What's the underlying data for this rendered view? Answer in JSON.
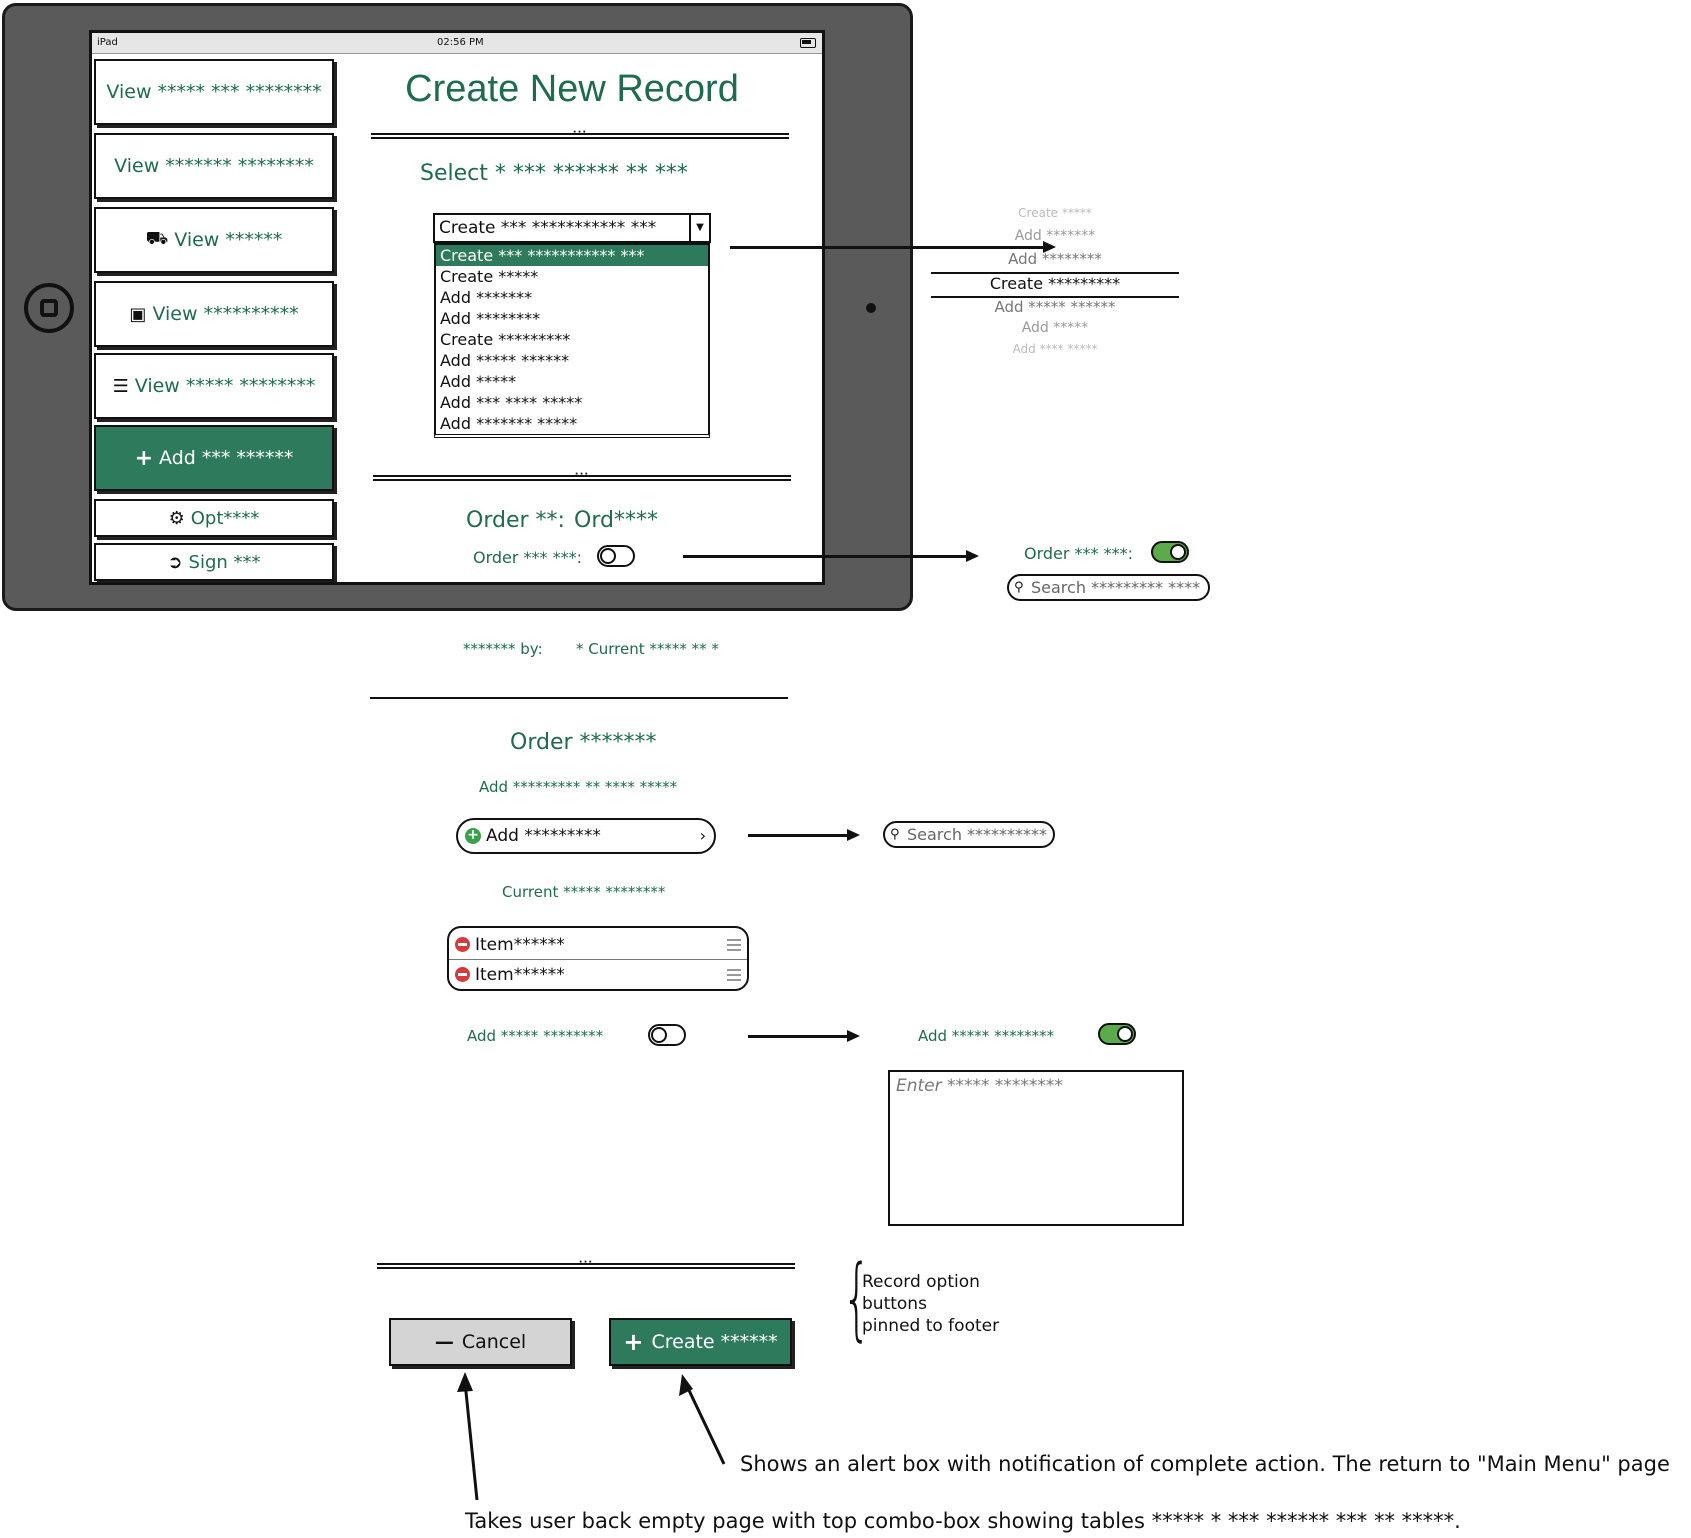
{
  "status_bar": {
    "device": "iPad",
    "time": "02:56 PM"
  },
  "sidebar": {
    "items": [
      {
        "label": "View ***** *** ********",
        "icon": ""
      },
      {
        "label": "View ******* ********",
        "icon": ""
      },
      {
        "label": "View ******",
        "icon": "truck-icon"
      },
      {
        "label": "View **********",
        "icon": "inbox-icon"
      },
      {
        "label": "View ***** ********",
        "icon": "database-icon"
      },
      {
        "label": "Add *** ******",
        "icon": "plus-icon"
      },
      {
        "label": "Opt****",
        "icon": "gear-icon"
      },
      {
        "label": "Sign ***",
        "icon": "sign-out-icon"
      }
    ]
  },
  "main": {
    "title": "Create New Record",
    "select_label": "Select * *** ****** ** ***",
    "combo_value": "Create *** *********** ***",
    "dropdown_options": [
      "Create *** *********** ***",
      "Create *****",
      "Add *******",
      "Add ********",
      "Create *********",
      "Add ***** ******",
      "Add *****",
      "Add *** **** *****",
      "Add ******* *****"
    ],
    "order_no_label": "Order **:",
    "order_no_value": "Ord****",
    "order_toggle_label": "Order *** ***:",
    "created_by_label": "******* by:",
    "created_by_value": "* Current ***** ** *",
    "order_section_title": "Order *******",
    "add_items_label": "Add ********* ** **** *****",
    "add_field_value": "Add *********",
    "current_items_label": "Current ***** ********",
    "current_items": [
      "Item******",
      "Item******"
    ],
    "add_toggle_label": "Add ***** ********",
    "cancel_label": "Cancel",
    "create_label": "Create ******"
  },
  "scroll_picker": [
    "Create *****",
    "Add *******",
    "Add ********",
    "Create *********",
    "Add ***** ******",
    "Add *****",
    "Add **** *****"
  ],
  "order_toggle_expanded": {
    "label": "Order *** ***:",
    "search_placeholder": "Search ********* ****"
  },
  "add_search_placeholder": "Search **********",
  "add_toggle_expanded": {
    "label": "Add ***** ********",
    "textarea_placeholder": "Enter ***** ********"
  },
  "annotations": {
    "footer_note_line1": "Record option",
    "footer_note_line2": "buttons",
    "footer_note_line3": "pinned to footer",
    "create_note": "Shows an alert box with notification of complete action. The return to \"Main Menu\" page",
    "cancel_note": "Takes user back empty page with top combo-box showing tables ***** * *** ****** *** ** *****."
  },
  "colors": {
    "accent": "#2d7a5c",
    "text_green": "#1e6b4f",
    "toggle_on": "#5cab4a",
    "remove": "#d63a3a"
  }
}
